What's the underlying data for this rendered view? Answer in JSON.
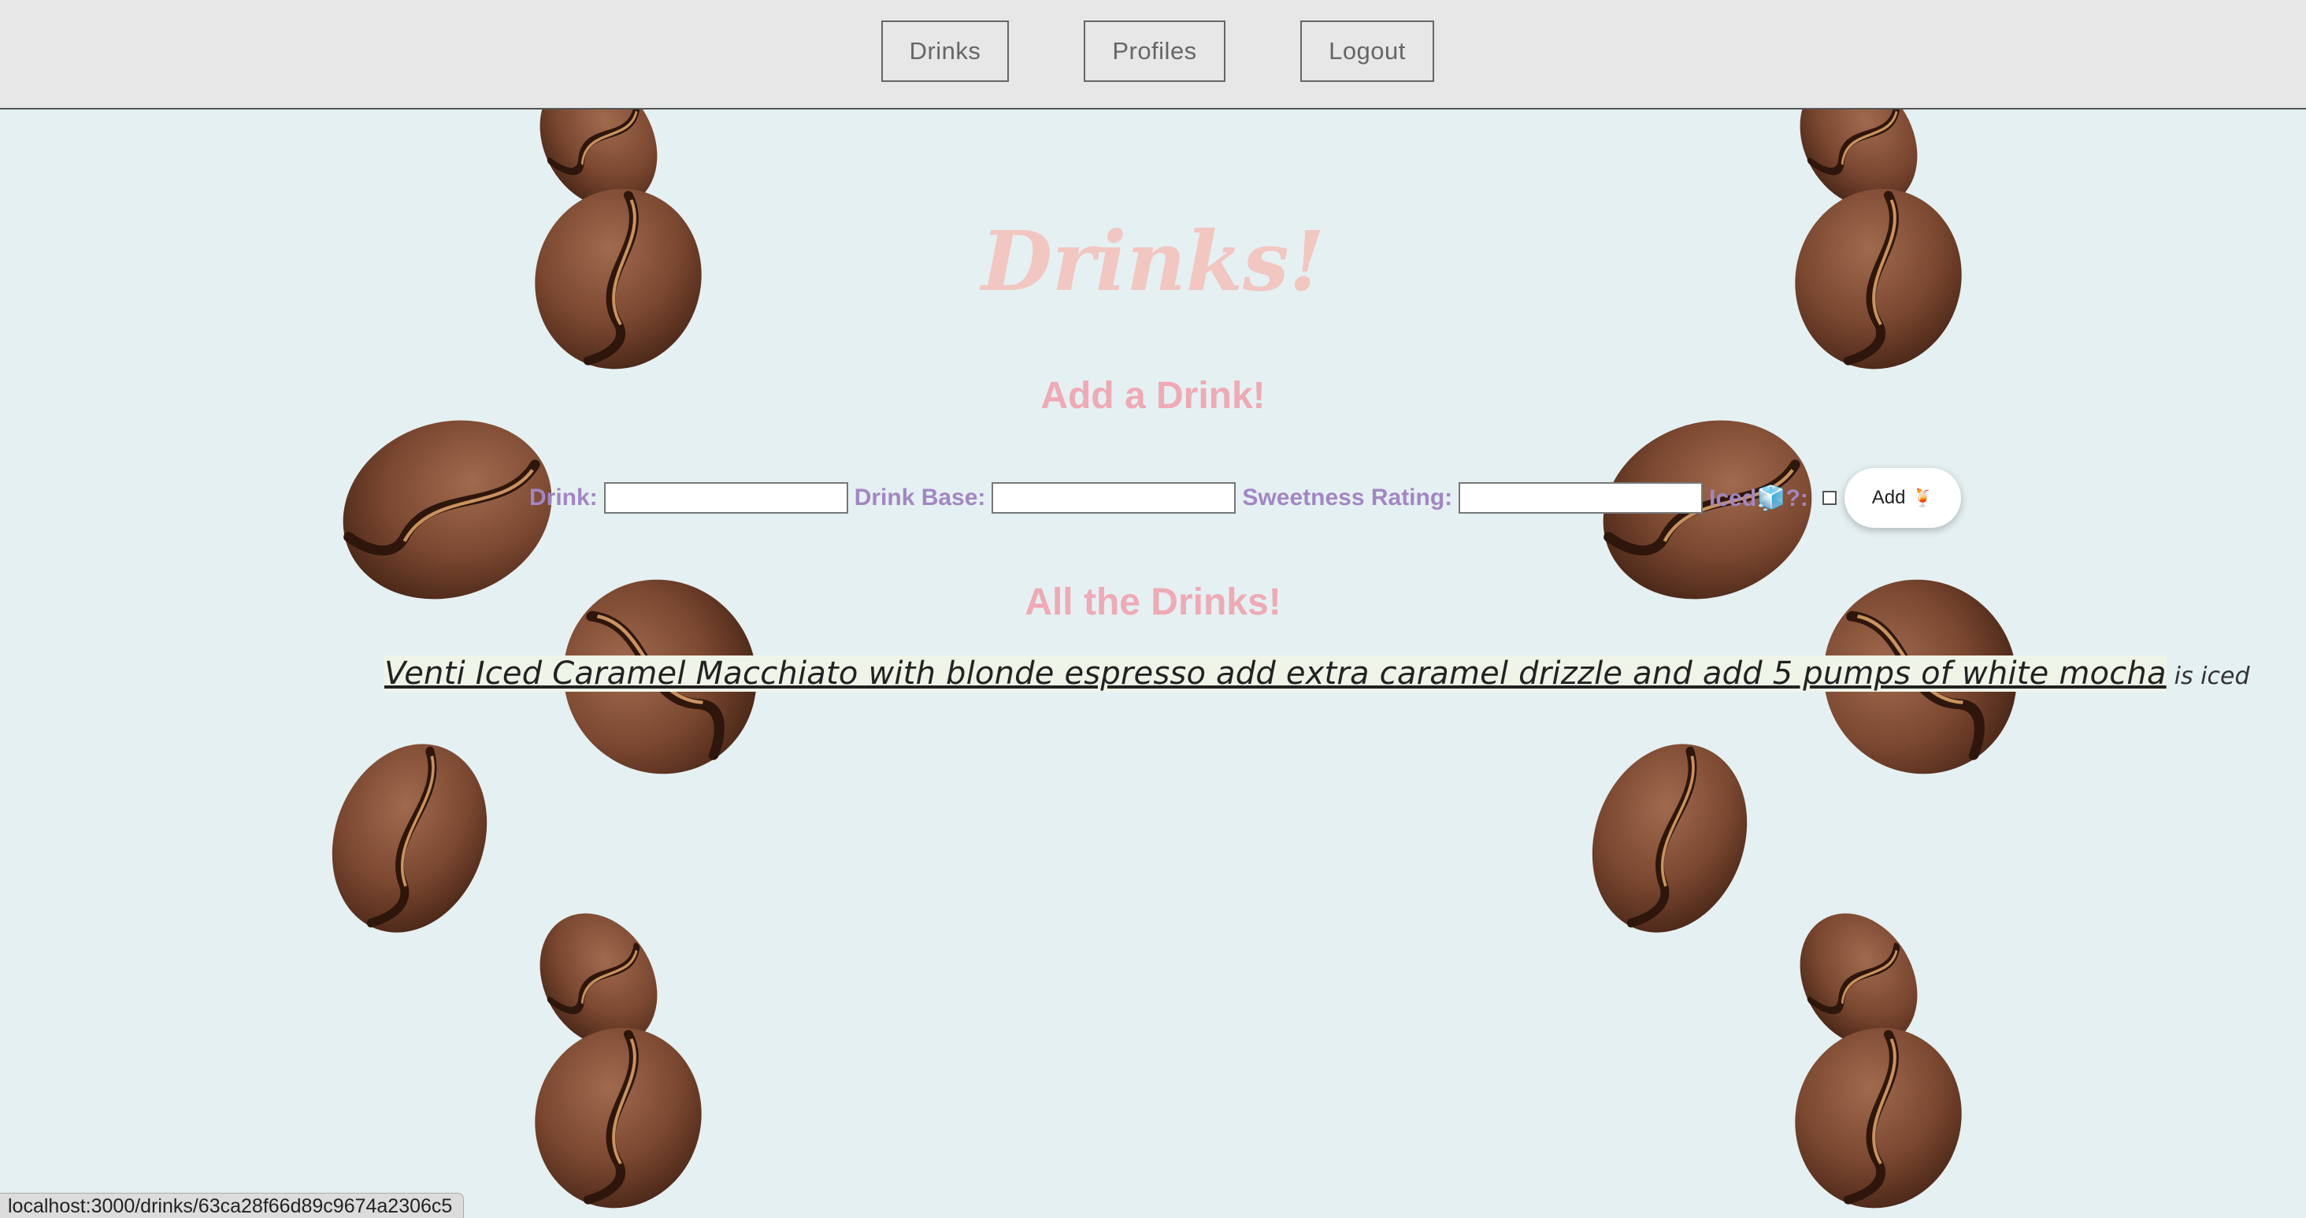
{
  "nav": {
    "drinks": "Drinks",
    "profiles": "Profiles",
    "logout": "Logout"
  },
  "page": {
    "title": "Drinks!",
    "add_title": "Add a Drink!",
    "all_title": "All the Drinks!"
  },
  "form": {
    "drink_label": "Drink:",
    "drink_value": "",
    "base_label": "Drink Base:",
    "base_value": "",
    "sweetness_label": "Sweetness Rating:",
    "sweetness_value": "",
    "iced_label": "Iced🧊?:",
    "iced_checked": false,
    "add_label": "Add",
    "add_emoji": "🍹"
  },
  "drinks": [
    {
      "name": "Venti Iced Caramel Macchiato with blonde espresso add extra caramel drizzle and add 5 pumps of white mocha",
      "suffix": "is iced"
    }
  ],
  "status_bar": {
    "url": "localhost:3000/drinks/63ca28f66d89c9674a2306c5"
  },
  "colors": {
    "background": "#e5f0f2",
    "title": "#f2c6c1",
    "subtitle": "#eeaab5",
    "label": "#a286c2",
    "nav_bg": "#e7e7e7"
  }
}
